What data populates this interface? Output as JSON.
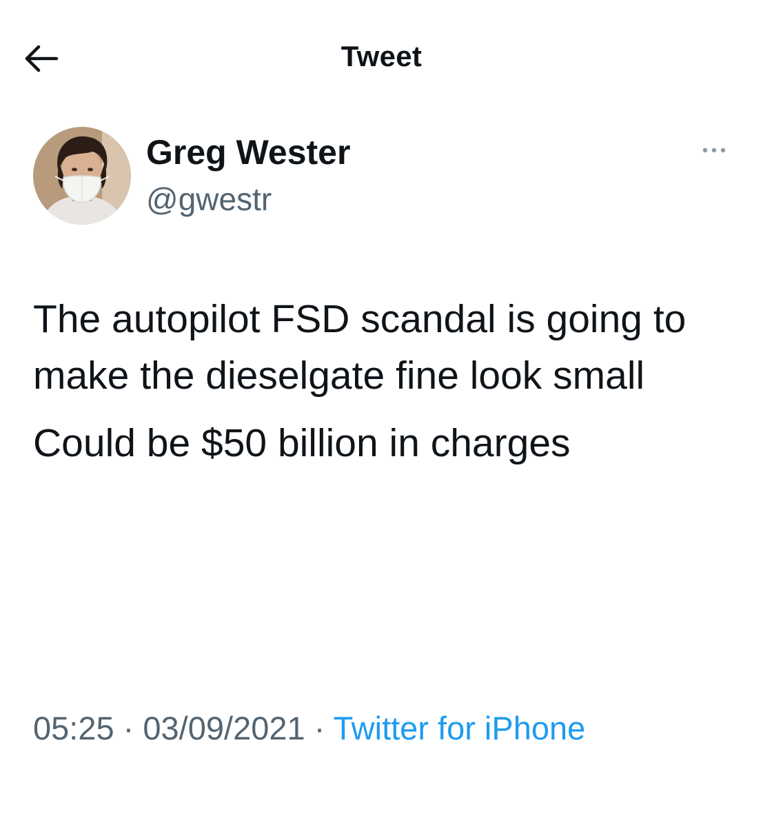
{
  "header": {
    "title": "Tweet"
  },
  "author": {
    "name": "Greg Wester",
    "handle": "@gwestr"
  },
  "tweet": {
    "paragraphs": [
      "The autopilot FSD scandal is going to make the dieselgate fine look small",
      "Could be $50 billion in charges"
    ]
  },
  "meta": {
    "time": "05:25",
    "separator": " · ",
    "date": "03/09/2021",
    "source": "Twitter for iPhone"
  },
  "icons": {
    "back": "back-arrow-icon",
    "more": "more-options-icon"
  },
  "colors": {
    "text": "#0f1419",
    "secondary": "#536471",
    "link": "#1d9bf0",
    "background": "#ffffff"
  }
}
